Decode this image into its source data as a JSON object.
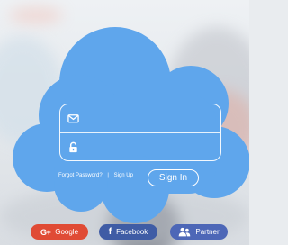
{
  "login": {
    "email_placeholder": "",
    "password_placeholder": "",
    "forgot_password": "Forgot Password?",
    "separator": "|",
    "sign_up": "Sign Up",
    "sign_in": "Sign In"
  },
  "social": {
    "google": "Google",
    "google_icon_text": "G+",
    "facebook": "Facebook",
    "facebook_icon_text": "f",
    "partner": "Partner"
  },
  "icons": {
    "email": "envelope-icon",
    "password": "lock-icon",
    "partner": "users-icon"
  },
  "colors": {
    "cloud": "#5fa6ec",
    "google": "#e04b35",
    "facebook": "#3f5ca5",
    "partner": "#4d67b7",
    "text": "#ffffff"
  }
}
